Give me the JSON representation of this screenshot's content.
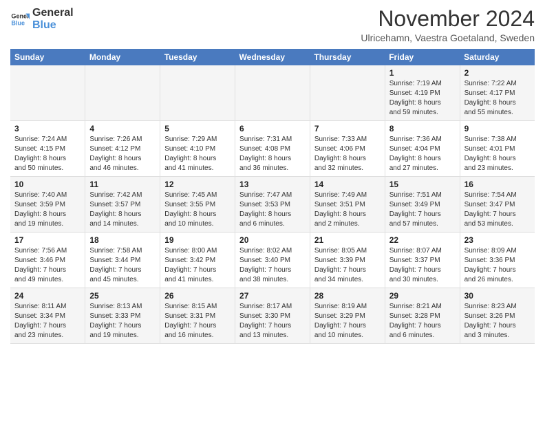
{
  "logo": {
    "line1": "General",
    "line2": "Blue"
  },
  "title": "November 2024",
  "subtitle": "Ulricehamn, Vaestra Goetaland, Sweden",
  "headers": [
    "Sunday",
    "Monday",
    "Tuesday",
    "Wednesday",
    "Thursday",
    "Friday",
    "Saturday"
  ],
  "weeks": [
    [
      {
        "day": "",
        "info": ""
      },
      {
        "day": "",
        "info": ""
      },
      {
        "day": "",
        "info": ""
      },
      {
        "day": "",
        "info": ""
      },
      {
        "day": "",
        "info": ""
      },
      {
        "day": "1",
        "info": "Sunrise: 7:19 AM\nSunset: 4:19 PM\nDaylight: 8 hours\nand 59 minutes."
      },
      {
        "day": "2",
        "info": "Sunrise: 7:22 AM\nSunset: 4:17 PM\nDaylight: 8 hours\nand 55 minutes."
      }
    ],
    [
      {
        "day": "3",
        "info": "Sunrise: 7:24 AM\nSunset: 4:15 PM\nDaylight: 8 hours\nand 50 minutes."
      },
      {
        "day": "4",
        "info": "Sunrise: 7:26 AM\nSunset: 4:12 PM\nDaylight: 8 hours\nand 46 minutes."
      },
      {
        "day": "5",
        "info": "Sunrise: 7:29 AM\nSunset: 4:10 PM\nDaylight: 8 hours\nand 41 minutes."
      },
      {
        "day": "6",
        "info": "Sunrise: 7:31 AM\nSunset: 4:08 PM\nDaylight: 8 hours\nand 36 minutes."
      },
      {
        "day": "7",
        "info": "Sunrise: 7:33 AM\nSunset: 4:06 PM\nDaylight: 8 hours\nand 32 minutes."
      },
      {
        "day": "8",
        "info": "Sunrise: 7:36 AM\nSunset: 4:04 PM\nDaylight: 8 hours\nand 27 minutes."
      },
      {
        "day": "9",
        "info": "Sunrise: 7:38 AM\nSunset: 4:01 PM\nDaylight: 8 hours\nand 23 minutes."
      }
    ],
    [
      {
        "day": "10",
        "info": "Sunrise: 7:40 AM\nSunset: 3:59 PM\nDaylight: 8 hours\nand 19 minutes."
      },
      {
        "day": "11",
        "info": "Sunrise: 7:42 AM\nSunset: 3:57 PM\nDaylight: 8 hours\nand 14 minutes."
      },
      {
        "day": "12",
        "info": "Sunrise: 7:45 AM\nSunset: 3:55 PM\nDaylight: 8 hours\nand 10 minutes."
      },
      {
        "day": "13",
        "info": "Sunrise: 7:47 AM\nSunset: 3:53 PM\nDaylight: 8 hours\nand 6 minutes."
      },
      {
        "day": "14",
        "info": "Sunrise: 7:49 AM\nSunset: 3:51 PM\nDaylight: 8 hours\nand 2 minutes."
      },
      {
        "day": "15",
        "info": "Sunrise: 7:51 AM\nSunset: 3:49 PM\nDaylight: 7 hours\nand 57 minutes."
      },
      {
        "day": "16",
        "info": "Sunrise: 7:54 AM\nSunset: 3:47 PM\nDaylight: 7 hours\nand 53 minutes."
      }
    ],
    [
      {
        "day": "17",
        "info": "Sunrise: 7:56 AM\nSunset: 3:46 PM\nDaylight: 7 hours\nand 49 minutes."
      },
      {
        "day": "18",
        "info": "Sunrise: 7:58 AM\nSunset: 3:44 PM\nDaylight: 7 hours\nand 45 minutes."
      },
      {
        "day": "19",
        "info": "Sunrise: 8:00 AM\nSunset: 3:42 PM\nDaylight: 7 hours\nand 41 minutes."
      },
      {
        "day": "20",
        "info": "Sunrise: 8:02 AM\nSunset: 3:40 PM\nDaylight: 7 hours\nand 38 minutes."
      },
      {
        "day": "21",
        "info": "Sunrise: 8:05 AM\nSunset: 3:39 PM\nDaylight: 7 hours\nand 34 minutes."
      },
      {
        "day": "22",
        "info": "Sunrise: 8:07 AM\nSunset: 3:37 PM\nDaylight: 7 hours\nand 30 minutes."
      },
      {
        "day": "23",
        "info": "Sunrise: 8:09 AM\nSunset: 3:36 PM\nDaylight: 7 hours\nand 26 minutes."
      }
    ],
    [
      {
        "day": "24",
        "info": "Sunrise: 8:11 AM\nSunset: 3:34 PM\nDaylight: 7 hours\nand 23 minutes."
      },
      {
        "day": "25",
        "info": "Sunrise: 8:13 AM\nSunset: 3:33 PM\nDaylight: 7 hours\nand 19 minutes."
      },
      {
        "day": "26",
        "info": "Sunrise: 8:15 AM\nSunset: 3:31 PM\nDaylight: 7 hours\nand 16 minutes."
      },
      {
        "day": "27",
        "info": "Sunrise: 8:17 AM\nSunset: 3:30 PM\nDaylight: 7 hours\nand 13 minutes."
      },
      {
        "day": "28",
        "info": "Sunrise: 8:19 AM\nSunset: 3:29 PM\nDaylight: 7 hours\nand 10 minutes."
      },
      {
        "day": "29",
        "info": "Sunrise: 8:21 AM\nSunset: 3:28 PM\nDaylight: 7 hours\nand 6 minutes."
      },
      {
        "day": "30",
        "info": "Sunrise: 8:23 AM\nSunset: 3:26 PM\nDaylight: 7 hours\nand 3 minutes."
      }
    ]
  ]
}
